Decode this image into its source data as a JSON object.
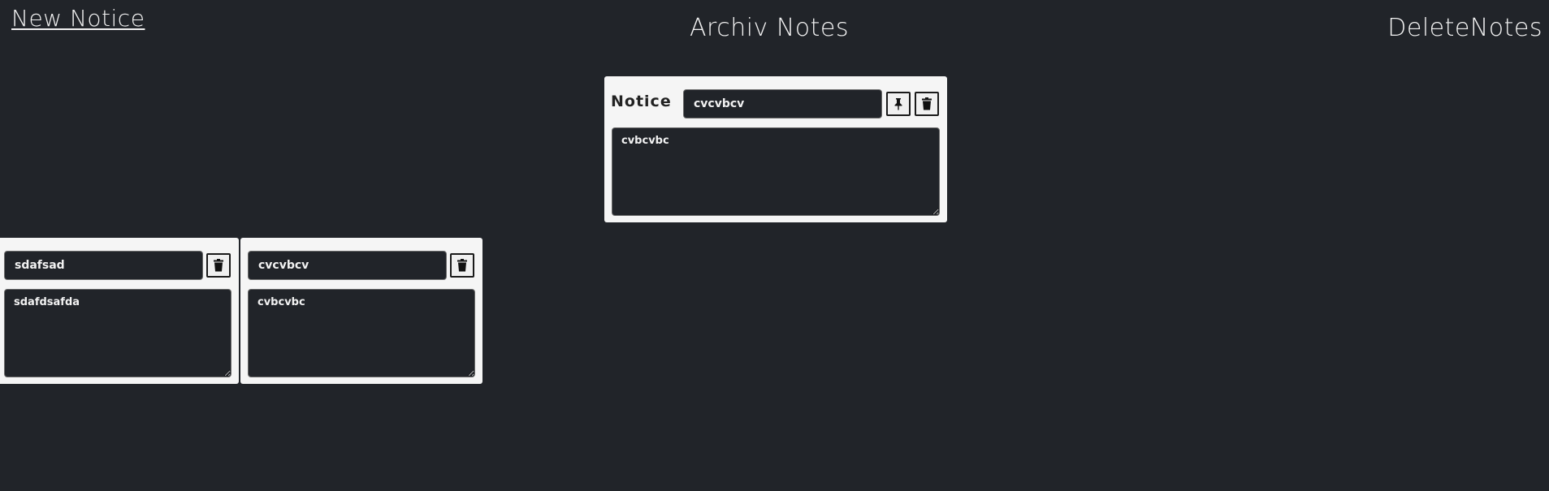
{
  "nav": {
    "new_notice": "New Notice",
    "archive": "Archiv Notes",
    "delete": "DeleteNotes"
  },
  "active_note": {
    "label": "Notice",
    "title": "cvcvbcv",
    "body": "cvbcvbc"
  },
  "notes": [
    {
      "title": "sdafsad",
      "body": "sdafdsafda"
    },
    {
      "title": "cvcvbcv",
      "body": "cvbcvbc"
    }
  ],
  "icons": {
    "pin": "pin-icon",
    "trash": "trash-icon"
  },
  "colors": {
    "background": "#212429",
    "card": "#f5f5f5",
    "text": "#f2f2f2"
  }
}
